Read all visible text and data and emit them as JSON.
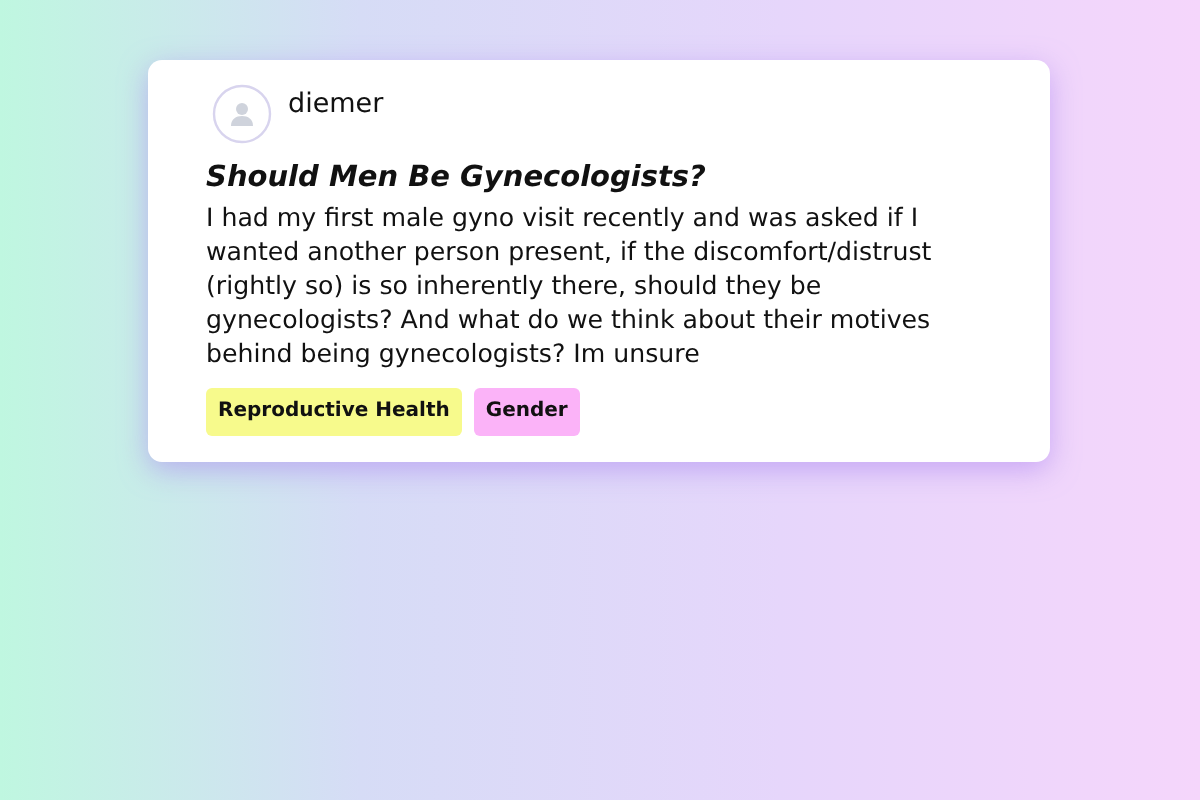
{
  "post": {
    "author": "diemer",
    "title": "Should Men Be Gynecologists?",
    "body": "I had my first male gyno visit recently and was asked if I wanted another person present, if the discomfort/distrust (rightly so) is so inherently there, should they be gynecologists? And what do we think about their motives behind being gynecologists? Im unsure",
    "tags": [
      {
        "label": "Reproductive Health",
        "color": "#f7fa8c"
      },
      {
        "label": "Gender",
        "color": "#fbb3f8"
      }
    ]
  }
}
